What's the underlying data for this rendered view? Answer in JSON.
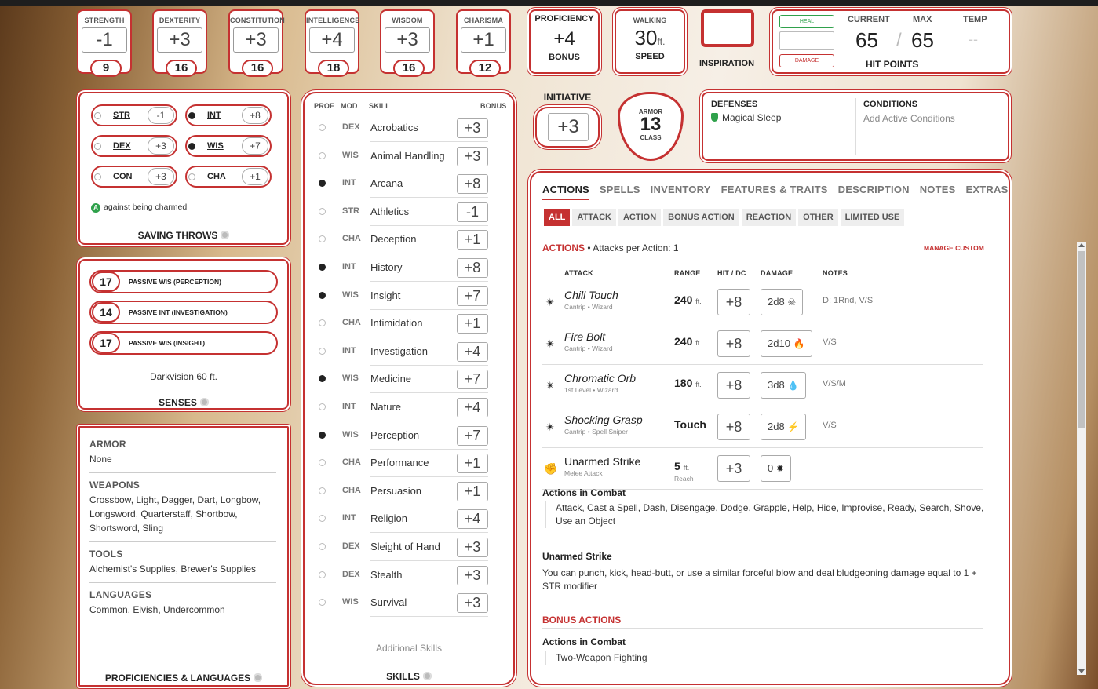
{
  "abilities": [
    {
      "name": "STRENGTH",
      "mod": "-1",
      "score": "9"
    },
    {
      "name": "DEXTERITY",
      "mod": "+3",
      "score": "16"
    },
    {
      "name": "CONSTITUTION",
      "mod": "+3",
      "score": "16"
    },
    {
      "name": "INTELLIGENCE",
      "mod": "+4",
      "score": "18"
    },
    {
      "name": "WISDOM",
      "mod": "+3",
      "score": "16"
    },
    {
      "name": "CHARISMA",
      "mod": "+1",
      "score": "12"
    }
  ],
  "proficiency": {
    "label": "PROFICIENCY",
    "value": "+4",
    "sub": "BONUS"
  },
  "speed": {
    "label": "WALKING",
    "value": "30",
    "unit": "ft.",
    "sub": "SPEED"
  },
  "inspiration": {
    "label": "INSPIRATION"
  },
  "hp": {
    "heal": "HEAL",
    "damage": "DAMAGE",
    "current_label": "CURRENT",
    "max_label": "MAX",
    "temp_label": "TEMP",
    "current": "65",
    "slash": "/",
    "max": "65",
    "temp": "--",
    "title": "HIT POINTS"
  },
  "initiative": {
    "label": "INITIATIVE",
    "value": "+3"
  },
  "armor": {
    "top": "ARMOR",
    "value": "13",
    "bottom": "CLASS"
  },
  "defenses": {
    "title": "DEFENSES",
    "items": [
      "Magical Sleep"
    ]
  },
  "conditions": {
    "title": "CONDITIONS",
    "placeholder": "Add Active Conditions"
  },
  "saving_throws": {
    "items": [
      {
        "name": "STR",
        "bonus": "-1",
        "prof": false
      },
      {
        "name": "INT",
        "bonus": "+8",
        "prof": true
      },
      {
        "name": "DEX",
        "bonus": "+3",
        "prof": false
      },
      {
        "name": "WIS",
        "bonus": "+7",
        "prof": true
      },
      {
        "name": "CON",
        "bonus": "+3",
        "prof": false
      },
      {
        "name": "CHA",
        "bonus": "+1",
        "prof": false
      }
    ],
    "note_badge": "A",
    "note": "against being charmed",
    "title": "SAVING THROWS"
  },
  "senses": {
    "passives": [
      {
        "value": "17",
        "label": "PASSIVE WIS (PERCEPTION)"
      },
      {
        "value": "14",
        "label": "PASSIVE INT (INVESTIGATION)"
      },
      {
        "value": "17",
        "label": "PASSIVE WIS (INSIGHT)"
      }
    ],
    "darkvision": "Darkvision 60 ft.",
    "title": "SENSES"
  },
  "proficiencies": {
    "sections": [
      {
        "h": "ARMOR",
        "t": "None"
      },
      {
        "h": "WEAPONS",
        "t": "Crossbow, Light, Dagger, Dart, Longbow, Longsword, Quarterstaff, Shortbow, Shortsword, Sling"
      },
      {
        "h": "TOOLS",
        "t": "Alchemist's Supplies, Brewer's Supplies"
      },
      {
        "h": "LANGUAGES",
        "t": "Common, Elvish, Undercommon"
      }
    ],
    "title": "PROFICIENCIES & LANGUAGES"
  },
  "skills": {
    "headers": {
      "prof": "PROF",
      "mod": "MOD",
      "skill": "SKILL",
      "bonus": "BONUS"
    },
    "items": [
      {
        "mod": "DEX",
        "name": "Acrobatics",
        "bonus": "+3",
        "prof": false
      },
      {
        "mod": "WIS",
        "name": "Animal Handling",
        "bonus": "+3",
        "prof": false
      },
      {
        "mod": "INT",
        "name": "Arcana",
        "bonus": "+8",
        "prof": true
      },
      {
        "mod": "STR",
        "name": "Athletics",
        "bonus": "-1",
        "prof": false
      },
      {
        "mod": "CHA",
        "name": "Deception",
        "bonus": "+1",
        "prof": false
      },
      {
        "mod": "INT",
        "name": "History",
        "bonus": "+8",
        "prof": true
      },
      {
        "mod": "WIS",
        "name": "Insight",
        "bonus": "+7",
        "prof": true
      },
      {
        "mod": "CHA",
        "name": "Intimidation",
        "bonus": "+1",
        "prof": false
      },
      {
        "mod": "INT",
        "name": "Investigation",
        "bonus": "+4",
        "prof": false
      },
      {
        "mod": "WIS",
        "name": "Medicine",
        "bonus": "+7",
        "prof": true
      },
      {
        "mod": "INT",
        "name": "Nature",
        "bonus": "+4",
        "prof": false
      },
      {
        "mod": "WIS",
        "name": "Perception",
        "bonus": "+7",
        "prof": true
      },
      {
        "mod": "CHA",
        "name": "Performance",
        "bonus": "+1",
        "prof": false
      },
      {
        "mod": "CHA",
        "name": "Persuasion",
        "bonus": "+1",
        "prof": false
      },
      {
        "mod": "INT",
        "name": "Religion",
        "bonus": "+4",
        "prof": false
      },
      {
        "mod": "DEX",
        "name": "Sleight of Hand",
        "bonus": "+3",
        "prof": false
      },
      {
        "mod": "DEX",
        "name": "Stealth",
        "bonus": "+3",
        "prof": false
      },
      {
        "mod": "WIS",
        "name": "Survival",
        "bonus": "+3",
        "prof": false
      }
    ],
    "additional": "Additional Skills",
    "title": "SKILLS"
  },
  "tabs": [
    "ACTIONS",
    "SPELLS",
    "INVENTORY",
    "FEATURES & TRAITS",
    "DESCRIPTION",
    "NOTES",
    "EXTRAS"
  ],
  "subtabs": [
    "ALL",
    "ATTACK",
    "ACTION",
    "BONUS ACTION",
    "REACTION",
    "OTHER",
    "LIMITED USE"
  ],
  "actions": {
    "heading": "ACTIONS",
    "per_action": "• Attacks per Action: 1",
    "manage": "MANAGE CUSTOM",
    "cols": {
      "attack": "ATTACK",
      "range": "RANGE",
      "hit": "HIT / DC",
      "damage": "DAMAGE",
      "notes": "NOTES"
    },
    "attacks": [
      {
        "icon": "spell-icon",
        "name": "Chill Touch",
        "sub": "Cantrip • Wizard",
        "range": "240",
        "unit": "ft.",
        "reach": "",
        "hit": "+8",
        "dmg": "2d8",
        "dmg_icon": "necrotic-icon",
        "notes": "D: 1Rnd, V/S"
      },
      {
        "icon": "spell-icon",
        "name": "Fire Bolt",
        "sub": "Cantrip • Wizard",
        "range": "240",
        "unit": "ft.",
        "reach": "",
        "hit": "+8",
        "dmg": "2d10",
        "dmg_icon": "fire-icon",
        "notes": "V/S"
      },
      {
        "icon": "spell-icon",
        "name": "Chromatic Orb",
        "sub": "1st Level • Wizard",
        "range": "180",
        "unit": "ft.",
        "reach": "",
        "hit": "+8",
        "dmg": "3d8",
        "dmg_icon": "acid-icon",
        "notes": "V/S/M"
      },
      {
        "icon": "spell-icon",
        "name": "Shocking Grasp",
        "sub": "Cantrip • Spell Sniper",
        "range": "Touch",
        "unit": "",
        "reach": "",
        "hit": "+8",
        "dmg": "2d8",
        "dmg_icon": "lightning-icon",
        "notes": "V/S"
      },
      {
        "icon": "melee-icon",
        "name": "Unarmed Strike",
        "sub": "Melee Attack",
        "range": "5",
        "unit": "ft.",
        "reach": "Reach",
        "hit": "+3",
        "dmg": "0",
        "dmg_icon": "bludgeoning-icon",
        "notes": ""
      }
    ],
    "combat_heading": "Actions in Combat",
    "combat_text": "Attack, Cast a Spell, Dash, Disengage, Dodge, Grapple, Help, Hide, Improvise, Ready, Search, Shove, Use an Object",
    "unarmed_heading": "Unarmed Strike",
    "unarmed_text": "You can punch, kick, head-butt, or use a similar forceful blow and deal bludgeoning damage equal to 1 + STR modifier",
    "bonus_heading": "BONUS ACTIONS",
    "bonus_combat_heading": "Actions in Combat",
    "bonus_combat_text": "Two-Weapon Fighting"
  },
  "colors": {
    "accent": "#c53131",
    "heal": "#2fa14b",
    "damage": "#c53131"
  }
}
